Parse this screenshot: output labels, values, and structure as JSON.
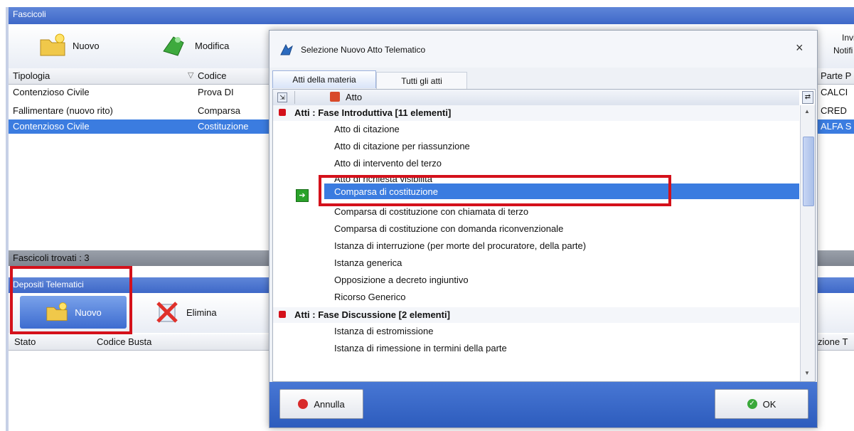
{
  "window": {
    "title": "Fascicoli"
  },
  "toolbar": {
    "new_label": "Nuovo",
    "edit_label": "Modifica",
    "right_label_1": "Invio",
    "right_label_2": "Notifi"
  },
  "main_table": {
    "headers": [
      "Tipologia",
      "Codice",
      "Parte P"
    ],
    "rows": [
      {
        "tipologia": "Contenzioso Civile",
        "codice": "Prova DI",
        "parte": "CALCI"
      },
      {
        "tipologia": "Fallimentare (nuovo rito)",
        "codice": "Comparsa",
        "parte": "CRED"
      },
      {
        "tipologia": "Contenzioso Civile",
        "codice": "Costituzione",
        "parte": "ALFA S"
      }
    ],
    "found_label": "Fascicoli trovati : 3"
  },
  "deposits": {
    "title": "Depositi Telematici",
    "new_label": "Nuovo",
    "delete_label": "Elimina",
    "headers": [
      "Stato",
      "Codice Busta",
      "zione T"
    ]
  },
  "dialog": {
    "title": "Selezione Nuovo Atto Telematico",
    "close": "×",
    "tabs": [
      "Atti della materia",
      "Tutti gli atti"
    ],
    "column_header": "Atto",
    "groups": [
      {
        "label": "Atti : Fase Introduttiva  [11 elementi]",
        "items": [
          "Atto di citazione",
          "Atto di citazione per riassunzione",
          "Atto di intervento del terzo",
          "Atto di richiesta visibilità",
          "Comparsa di costituzione",
          "Comparsa di costituzione con chiamata di terzo",
          "Comparsa di costituzione con domanda riconvenzionale",
          "Istanza di interruzione (per morte del procuratore, della parte)",
          "Istanza generica",
          "Opposizione a decreto ingiuntivo",
          "Ricorso Generico"
        ]
      },
      {
        "label": "Atti : Fase Discussione  [2 elementi]",
        "items": [
          "Istanza di estromissione",
          "Istanza di rimessione in termini della parte"
        ]
      }
    ],
    "cancel_label": "Annulla",
    "ok_label": "OK"
  },
  "colors": {
    "selection": "#3b7ce0",
    "highlight_box": "#d4111b",
    "footer": "#3a68c8"
  }
}
